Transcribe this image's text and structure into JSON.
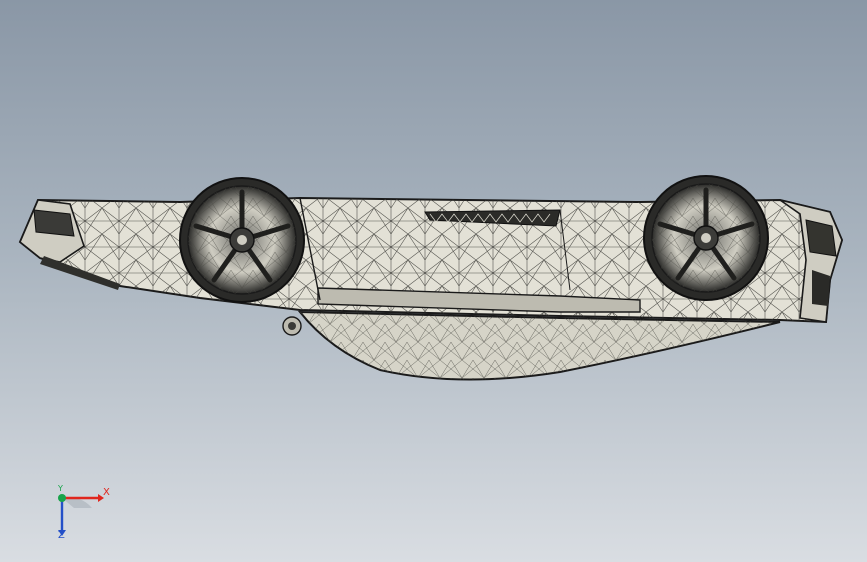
{
  "viewport": {
    "background_top": "#8a97a6",
    "background_bottom": "#d9dde2",
    "model_fill": "#e3e1d6",
    "model_edge": "#1a1a1a",
    "display_mode": "shaded-with-edges"
  },
  "triad": {
    "x_label": "X",
    "y_label": "Y",
    "z_label": "Z",
    "x_color": "#e0261d",
    "y_color": "#17a34a",
    "z_color": "#2450c8"
  }
}
